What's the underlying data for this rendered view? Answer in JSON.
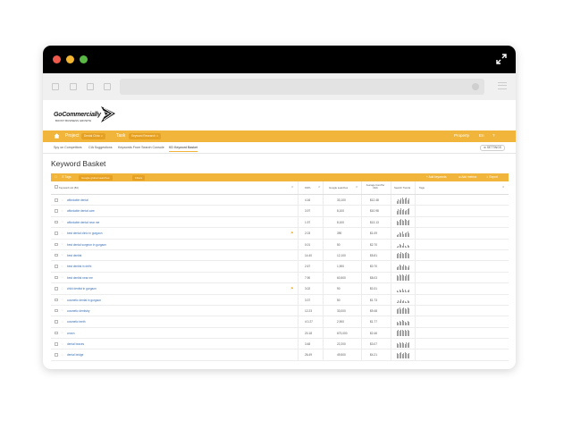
{
  "browser": {
    "title_controls": [
      "close",
      "minimize",
      "maximize"
    ]
  },
  "brand": {
    "name": "GoCommercially",
    "tagline": "BOOST BUSINESS GROWTH"
  },
  "toolbar": {
    "project_label": "Project",
    "project_value": "Dental Clinic ∨",
    "task_label": "Task",
    "task_value": "Keyword Research ∨",
    "right_label": "Property",
    "right_items": [
      "En",
      "?"
    ]
  },
  "tabs": [
    {
      "label": "Spy on Competitors"
    },
    {
      "label": "CIA Suggestions"
    },
    {
      "label": "Keywords From Search Console"
    },
    {
      "label": "KD Keyword Basket",
      "active": true
    }
  ],
  "settings_button": "⚙ SETTINGS",
  "page_title": "Keyword Basket",
  "basket_bar": {
    "tag_label": "☰ Tags",
    "chip1": "Google global searches",
    "chip2": "Filters",
    "actions": [
      "+ Add keywords",
      "⊞ Add metrics",
      "⇩ Export"
    ]
  },
  "table": {
    "headers": {
      "keyword": "Keyword List (84)",
      "kd": "KD%",
      "searches": "Google searches",
      "cpc": "Average Cost Per Click",
      "trends": "Search Trends",
      "tags": "Tags"
    },
    "rows": [
      {
        "keyword": "affordable dental",
        "kd": "4.16",
        "searches": "33,100",
        "cpc": "$12.48",
        "flag": false
      },
      {
        "keyword": "affordable dental care",
        "kd": "3.97",
        "searches": "8,100",
        "cpc": "$10.98",
        "flag": false
      },
      {
        "keyword": "affordable dental near me",
        "kd": "1.97",
        "searches": "8,100",
        "cpc": "$13.13",
        "flag": false
      },
      {
        "keyword": "best dental clinic in gurgaon",
        "kd": "2.03",
        "searches": "390",
        "cpc": "$1.09",
        "flag": true
      },
      {
        "keyword": "best dental surgeon in gurgaon",
        "kd": "0.01",
        "searches": "50",
        "cpc": "$2.70",
        "flag": false
      },
      {
        "keyword": "best dentist",
        "kd": "14.40",
        "searches": "12,100",
        "cpc": "$5.81",
        "flag": false
      },
      {
        "keyword": "best dentist in delhi",
        "kd": "2.67",
        "searches": "1,900",
        "cpc": "$0.70",
        "flag": false
      },
      {
        "keyword": "best dentist near me",
        "kd": "7.90",
        "searches": "60,500",
        "cpc": "$8.03",
        "flag": false
      },
      {
        "keyword": "child dentist in gurgaon",
        "kd": "3.02",
        "searches": "90",
        "cpc": "$0.31",
        "flag": true
      },
      {
        "keyword": "cosmetic dental in gurgaon",
        "kd": "3.37",
        "searches": "50",
        "cpc": "$1.73",
        "flag": false
      },
      {
        "keyword": "cosmetic dentistry",
        "kd": "12.23",
        "searches": "33,000",
        "cpc": "$9.48",
        "flag": false
      },
      {
        "keyword": "cosmetic teeth",
        "kd": "4 0.27",
        "searches": "2,900",
        "cpc": "$1.77",
        "flag": false
      },
      {
        "keyword": "crown",
        "kd": "20.18",
        "searches": "673,000",
        "cpc": "$2.46",
        "flag": false
      },
      {
        "keyword": "dental braces",
        "kd": "3.48",
        "searches": "22,200",
        "cpc": "$3.07",
        "flag": false
      },
      {
        "keyword": "dental bridge",
        "kd": "26.49",
        "searches": "49,500",
        "cpc": "$4.21",
        "flag": false
      }
    ]
  }
}
